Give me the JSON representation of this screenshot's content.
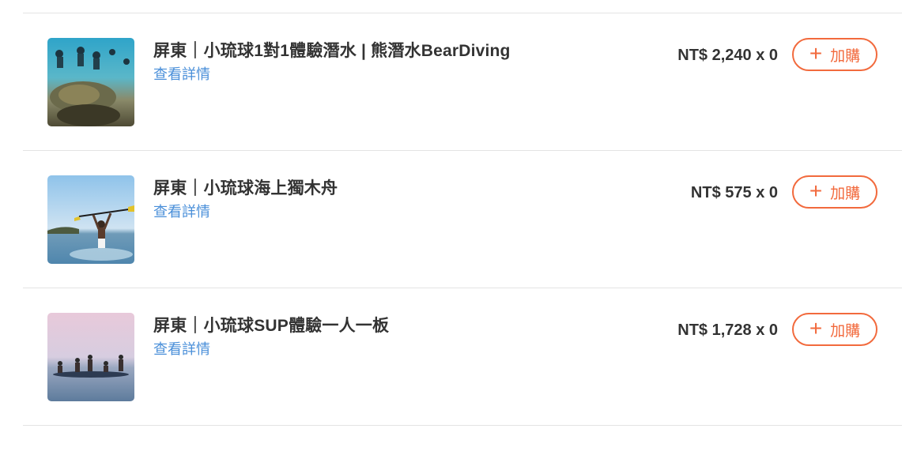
{
  "products": [
    {
      "title": "屏東｜小琉球1對1體驗潛水 | 熊潛水BearDiving",
      "details_label": "查看詳情",
      "price": "NT$ 2,240 x 0",
      "add_label": "加購",
      "add_icon": "plus-icon",
      "image_subject": "diving-sea-turtle"
    },
    {
      "title": "屏東｜小琉球海上獨木舟",
      "details_label": "查看詳情",
      "price": "NT$ 575 x 0",
      "add_label": "加購",
      "add_icon": "plus-icon",
      "image_subject": "kayak-paddle-raised"
    },
    {
      "title": "屏東｜小琉球SUP體驗一人一板",
      "details_label": "查看詳情",
      "price": "NT$ 1,728 x 0",
      "add_label": "加購",
      "add_icon": "plus-icon",
      "image_subject": "sup-group"
    }
  ],
  "colors": {
    "accent": "#f26a3d",
    "link": "#4a8fd9",
    "text": "#333333",
    "divider": "#e3e3e3"
  }
}
